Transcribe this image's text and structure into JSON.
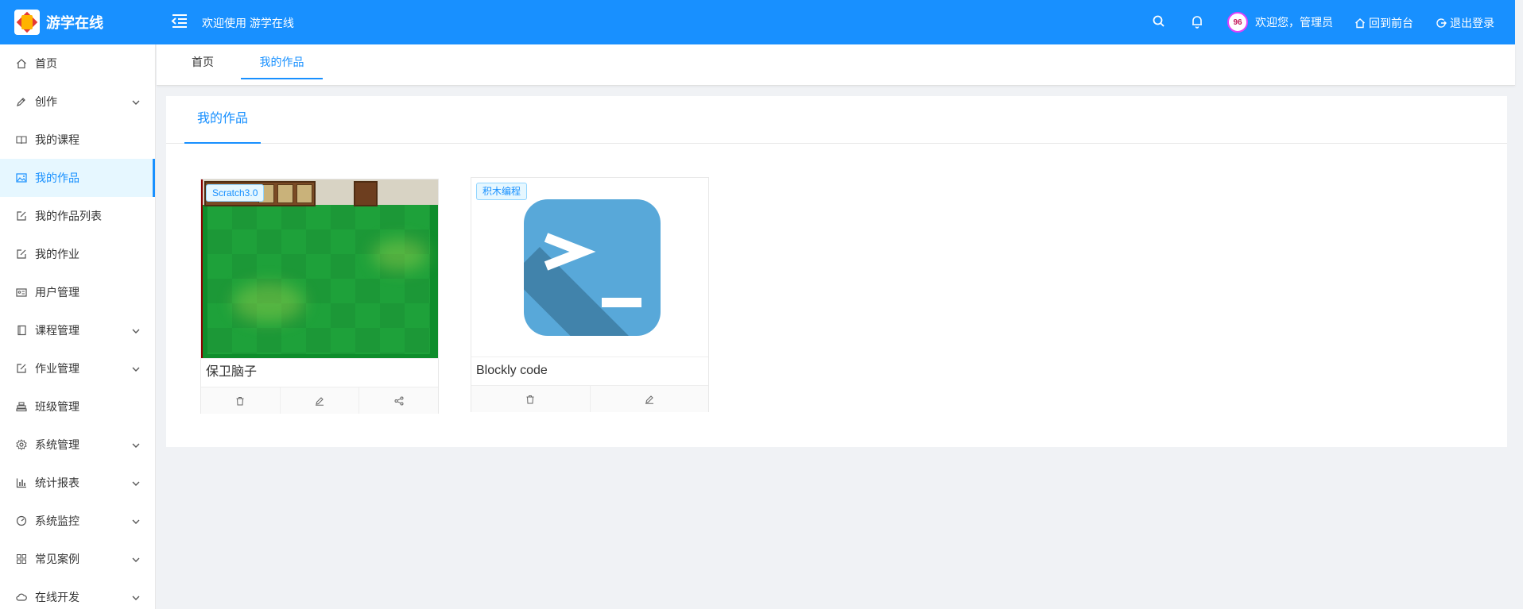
{
  "app": {
    "logo_text": "游学在线",
    "welcome_text": "欢迎使用 游学在线"
  },
  "header": {
    "user_greeting": "欢迎您，管理员",
    "back_front": "回到前台",
    "logout": "退出登录"
  },
  "sidebar": {
    "items": [
      {
        "label": "首页",
        "icon": "home-icon",
        "expandable": false
      },
      {
        "label": "创作",
        "icon": "pen-icon",
        "expandable": true
      },
      {
        "label": "我的课程",
        "icon": "book-icon",
        "expandable": false
      },
      {
        "label": "我的作品",
        "icon": "picture-icon",
        "expandable": false,
        "active": true
      },
      {
        "label": "我的作品列表",
        "icon": "edit-icon",
        "expandable": false
      },
      {
        "label": "我的作业",
        "icon": "edit-icon",
        "expandable": false
      },
      {
        "label": "用户管理",
        "icon": "id-card-icon",
        "expandable": false
      },
      {
        "label": "课程管理",
        "icon": "document-icon",
        "expandable": true
      },
      {
        "label": "作业管理",
        "icon": "edit-icon",
        "expandable": true
      },
      {
        "label": "班级管理",
        "icon": "class-icon",
        "expandable": false
      },
      {
        "label": "系统管理",
        "icon": "gear-icon",
        "expandable": true
      },
      {
        "label": "统计报表",
        "icon": "bar-chart-icon",
        "expandable": true
      },
      {
        "label": "系统监控",
        "icon": "dashboard-icon",
        "expandable": true
      },
      {
        "label": "常见案例",
        "icon": "apps-icon",
        "expandable": true
      },
      {
        "label": "在线开发",
        "icon": "cloud-icon",
        "expandable": true
      }
    ]
  },
  "tabs": [
    {
      "label": "首页",
      "active": false
    },
    {
      "label": "我的作品",
      "active": true
    }
  ],
  "panel": {
    "tab_label": "我的作品"
  },
  "works": [
    {
      "title": "保卫脑子",
      "badge": "Scratch3.0",
      "actions": [
        "delete",
        "edit",
        "share"
      ]
    },
    {
      "title": "Blockly code",
      "badge": "积木编程",
      "actions": [
        "delete",
        "edit"
      ]
    }
  ],
  "colors": {
    "primary": "#1890ff",
    "background": "#f0f2f5",
    "active_bg": "#e6f7ff"
  }
}
